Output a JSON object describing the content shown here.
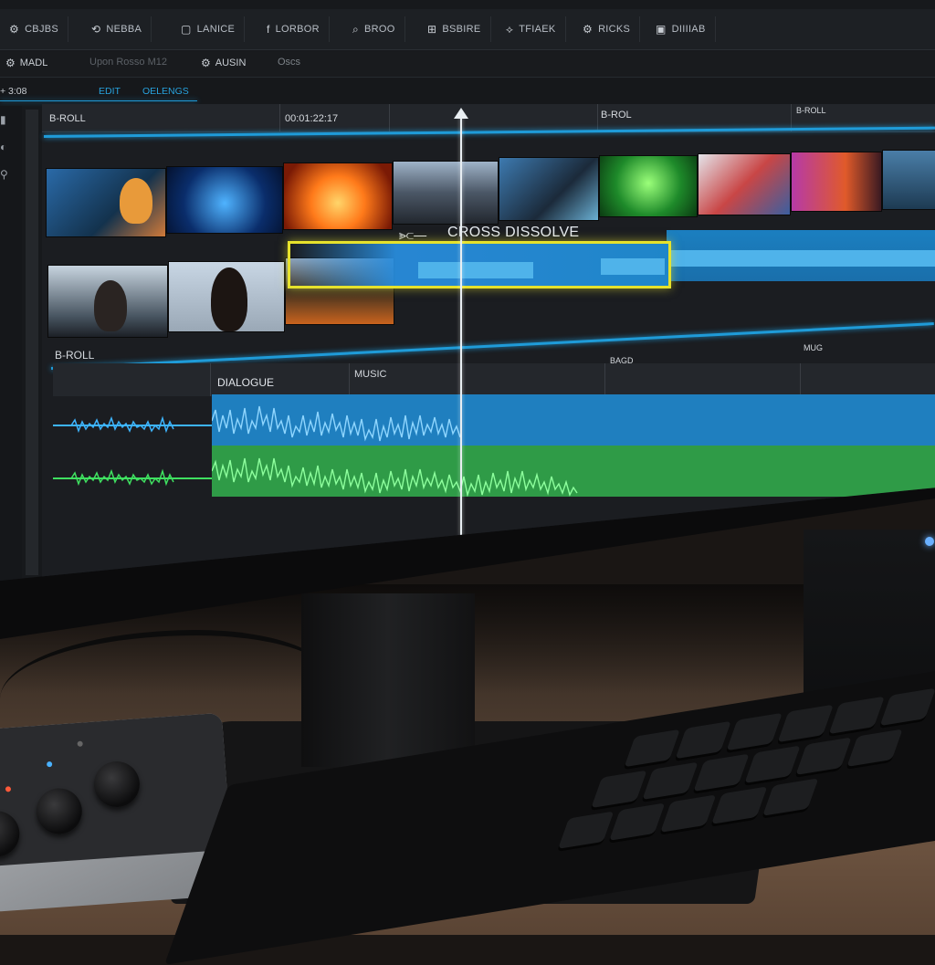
{
  "menu": {
    "items": [
      {
        "label": "CBJBS",
        "icon": "⚙"
      },
      {
        "label": "NEBBA",
        "icon": "⟲"
      },
      {
        "label": "LANICE",
        "icon": "▢"
      },
      {
        "label": "LORBOR",
        "icon": "f"
      },
      {
        "label": "BROO",
        "icon": "⌕"
      },
      {
        "label": "BSBIRE",
        "icon": "⊞"
      },
      {
        "label": "TFIAEK",
        "icon": "⟡"
      },
      {
        "label": "RICKS",
        "icon": "⚙"
      },
      {
        "label": "DIIIIAB",
        "icon": "▣"
      }
    ]
  },
  "subbar": {
    "mode": "MADL",
    "project": "Upon Rosso M12",
    "audio": "AUSIN",
    "extra": "Oscs"
  },
  "tools": {
    "timecode": "+ 3:08",
    "edit": "EDIT",
    "tab": "OELENGS"
  },
  "timeline": {
    "track_label_top": "B-ROLL",
    "timecode": "00:01:22:17",
    "track_label_mid": "B-ROLL",
    "track_label_right": "B-ROL",
    "track_label_b": "B-ROLL",
    "transition": "CROSS DISSOLVE",
    "audio_dialogue": "DIALOGUE",
    "audio_music": "MUSIC",
    "audio_right1": "BAGD",
    "audio_right2": "MUG"
  },
  "colors": {
    "accent_blue": "#1f9bd8",
    "dialogue_blue": "#1f7fbf",
    "music_green": "#2f9b47",
    "selection_yellow": "#e6e22c"
  }
}
